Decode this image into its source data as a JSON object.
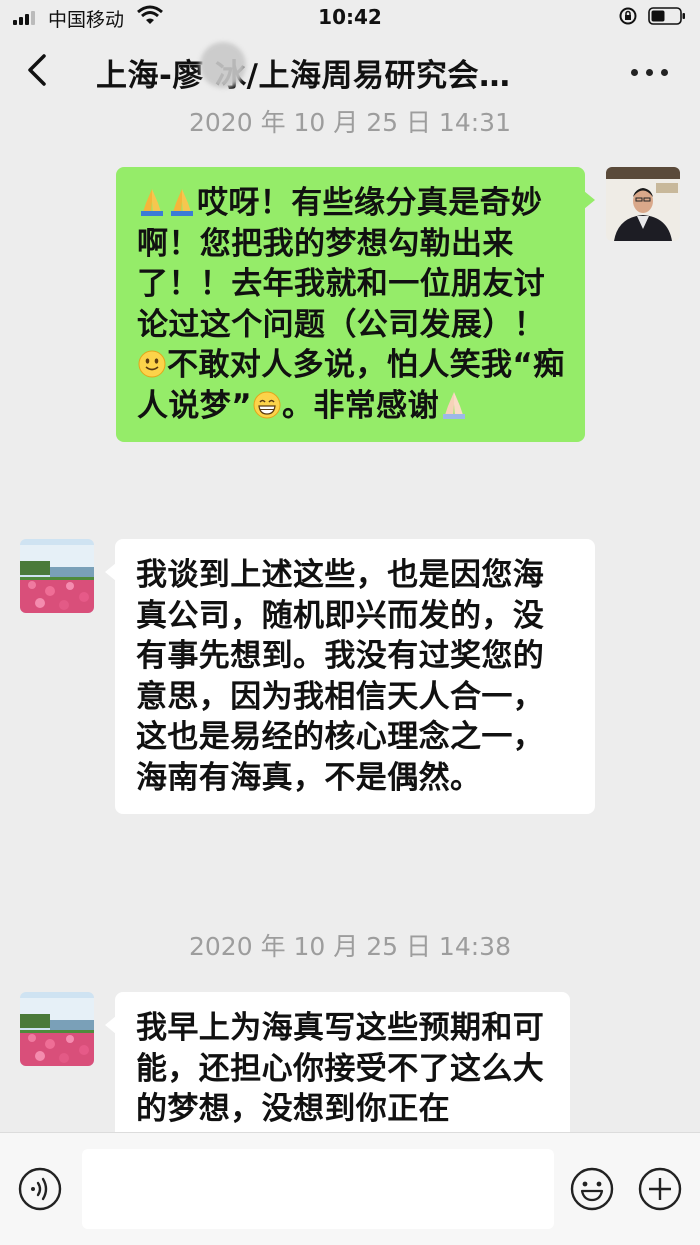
{
  "status_bar": {
    "carrier": "中国移动",
    "time": "10:42"
  },
  "nav": {
    "title": "上海-廖 冰/上海周易研究会…"
  },
  "messages": [
    {
      "timestamp": "2020 年 10 月 25 日 14:31",
      "sender": "self",
      "text_parts": [
        "哎呀！有些缘分真是奇妙啊！您把我的梦想勾勒出来了！！去年我就和一位朋友讨论过这个问题（公司发展）！",
        "不敢对人多说，怕人笑我“痴人说梦”",
        "。非常感谢"
      ]
    },
    {
      "sender": "other",
      "text": "我谈到上述这些，也是因您海真公司，随机即兴而发的，没有事先想到。我没有过奖您的意思，因为我相信天人合一，这也是易经的核心理念之一，海南有海真，不是偶然。"
    },
    {
      "timestamp": "2020 年 10 月 25 日 14:38",
      "sender": "other",
      "text": "我早上为海真写这些预期和可能，还担心你接受不了这么大的梦想，没想到你正在"
    }
  ],
  "icons": [
    "back-icon",
    "more-icon",
    "voice-icon",
    "emoji-icon",
    "plus-icon",
    "pray-emoji",
    "smile-emoji",
    "grin-emoji"
  ],
  "colors": {
    "self_bubble": "#95ec69",
    "other_bubble": "#ffffff",
    "background": "#ededed"
  }
}
